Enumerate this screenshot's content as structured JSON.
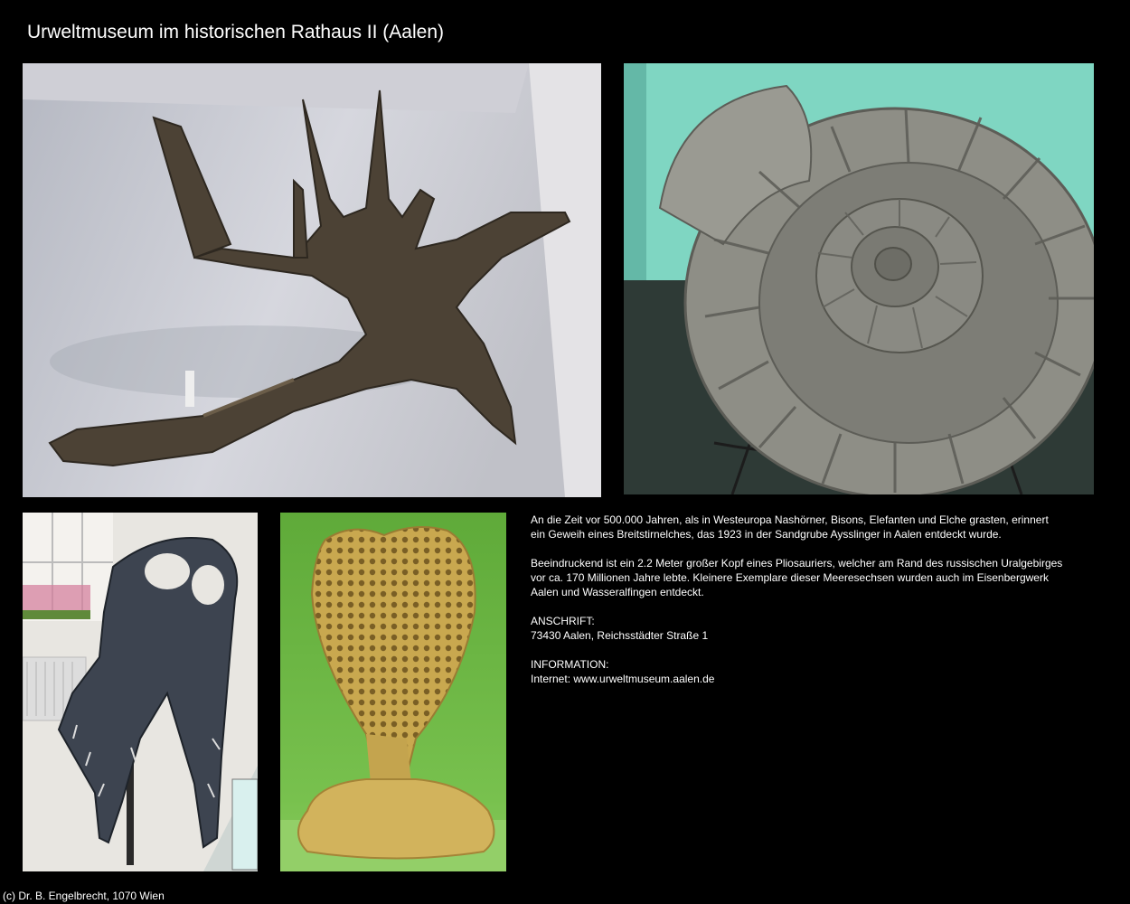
{
  "title": "Urweltmuseum im historischen Rathaus II (Aalen)",
  "description": {
    "paragraph1": [
      "An die Zeit vor 500.000 Jahren, als in Westeuropa Nashörner, Bisons, Elefanten und Elche grasten, erinnert",
      "ein Geweih eines Breitstirnelches, das 1923 in der Sandgrube Aysslinger in Aalen entdeckt wurde."
    ],
    "paragraph2": [
      "Beeindruckend ist ein 2.2 Meter  großer Kopf eines Pliosauriers, welcher am Rand des russischen Uralgebirges",
      "vor ca. 170 Millionen Jahre lebte. Kleinere Exemplare dieser Meeresechsen wurden auch im Eisenbergwerk",
      "Aalen und Wasseralfingen entdeckt."
    ],
    "address_label": "ANSCHRIFT:",
    "address": "73430 Aalen, Reichsstädter Straße 1",
    "info_label": "INFORMATION:",
    "info": "Internet: www.urweltmuseum.aalen.de"
  },
  "copyright": "(c) Dr. B. Engelbrecht, 1070 Wien",
  "colors": {
    "background": "#000000",
    "text": "#ffffff",
    "antler_wall": "#c9cbd3",
    "ammonite_wall": "#7fd6c2",
    "ammonite_stone": "#8e8e86",
    "coral_bg": "#6dbb45",
    "coral": "#c9a84f"
  }
}
